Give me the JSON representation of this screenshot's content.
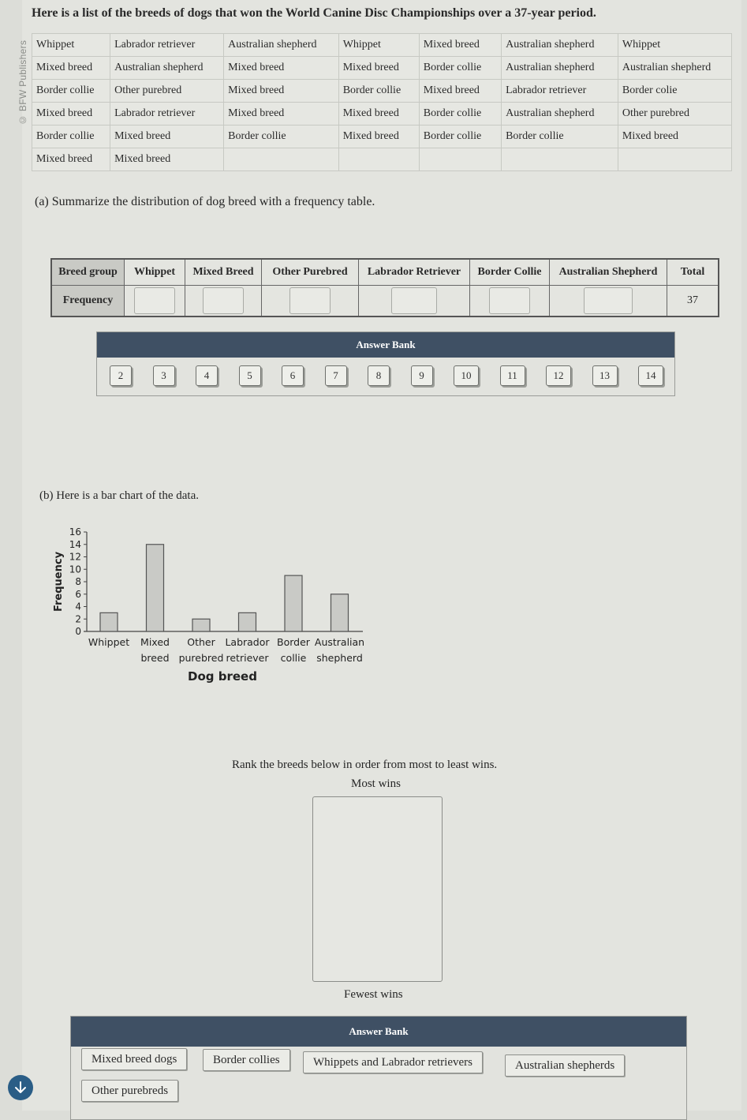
{
  "watermark": "© BFW Publishers",
  "intro": "Here is a list of the breeds of dogs that won the World Canine Disc Championships over a 37-year period.",
  "breed_list": {
    "rows": [
      [
        "Whippet",
        "Labrador retriever",
        "Australian shepherd",
        "Whippet",
        "Mixed breed",
        "Australian shepherd",
        "Whippet"
      ],
      [
        "Mixed breed",
        "Australian shepherd",
        "Mixed breed",
        "Mixed breed",
        "Border collie",
        "Australian shepherd",
        "Australian shepherd"
      ],
      [
        "Border collie",
        "Other purebred",
        "Mixed breed",
        "Border collie",
        "Mixed breed",
        "Labrador retriever",
        "Border colie"
      ],
      [
        "Mixed breed",
        "Labrador retriever",
        "Mixed breed",
        "Mixed breed",
        "Border collie",
        "Australian shepherd",
        "Other purebred"
      ],
      [
        "Border collie",
        "Mixed breed",
        "Border collie",
        "Mixed breed",
        "Border collie",
        "Border collie",
        "Mixed breed"
      ],
      [
        "Mixed breed",
        "Mixed breed",
        "",
        "",
        "",
        "",
        ""
      ]
    ]
  },
  "part_a": {
    "prompt": "(a) Summarize the distribution of dog breed with a frequency table.",
    "table": {
      "header_label": "Breed group",
      "row_label": "Frequency",
      "columns": [
        "Whippet",
        "Mixed Breed",
        "Other Purebred",
        "Labrador Retriever",
        "Border Collie",
        "Australian Shepherd",
        "Total"
      ],
      "values": [
        "",
        "",
        "",
        "",
        "",
        "",
        "37"
      ]
    },
    "answer_bank": {
      "title": "Answer Bank",
      "items": [
        "2",
        "3",
        "4",
        "5",
        "6",
        "7",
        "8",
        "9",
        "10",
        "11",
        "12",
        "13",
        "14"
      ]
    }
  },
  "part_b": {
    "prompt": "(b) Here is a bar chart of the data.",
    "rank_prompt": "Rank the breeds below in order from most to least wins.",
    "most_label": "Most wins",
    "fewest_label": "Fewest wins",
    "answer_bank": {
      "title": "Answer Bank",
      "items": [
        "Mixed breed dogs",
        "Border collies",
        "Whippets and Labrador retrievers",
        "Australian shepherds",
        "Other purebreds"
      ]
    }
  },
  "chart_data": {
    "type": "bar",
    "title": "",
    "xlabel": "Dog breed",
    "ylabel": "Frequency",
    "categories": [
      [
        "Whippet"
      ],
      [
        "Mixed",
        "breed"
      ],
      [
        "Other",
        "purebred"
      ],
      [
        "Labrador",
        "retriever"
      ],
      [
        "Border",
        "collie"
      ],
      [
        "Australian",
        "shepherd"
      ]
    ],
    "values": [
      3,
      14,
      2,
      3,
      9,
      6
    ],
    "ylim": [
      0,
      16
    ],
    "yticks": [
      0,
      2,
      4,
      6,
      8,
      10,
      12,
      14,
      16
    ],
    "grid": false,
    "legend": "none"
  },
  "scroll_button": "scroll-down"
}
